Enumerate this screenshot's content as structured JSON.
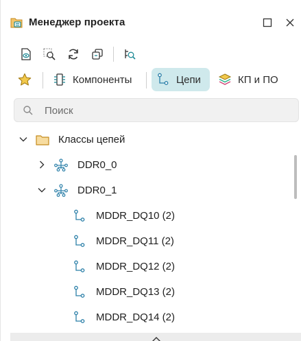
{
  "panel": {
    "title": "Менеджер проекта",
    "title_icon": "project-manager-icon",
    "window_buttons": [
      "maximize-icon",
      "close-icon"
    ]
  },
  "toolbar": {
    "buttons": [
      "document-view-icon",
      "zoom-select-icon",
      "refresh-icon",
      "copy-layers-icon",
      "inspect-net-icon"
    ]
  },
  "tabs": [
    {
      "label": "",
      "icon": "star-icon",
      "active": false
    },
    {
      "label": "Компоненты",
      "icon": "component-icon",
      "active": false
    },
    {
      "label": "Цепи",
      "icon": "net-icon",
      "active": true
    },
    {
      "label": "КП и ПО",
      "icon": "layers-stack-icon",
      "active": false
    }
  ],
  "search": {
    "placeholder": "Поиск",
    "value": ""
  },
  "tree": {
    "root": {
      "label": "Классы цепей",
      "expanded": true,
      "icon": "folder-icon"
    },
    "groups": [
      {
        "label": "DDR0_0",
        "expanded": false,
        "icon": "net-class-icon"
      },
      {
        "label": "DDR0_1",
        "expanded": true,
        "icon": "net-class-icon"
      }
    ],
    "nets": [
      {
        "label": "MDDR_DQ10 (2)",
        "icon": "net-icon"
      },
      {
        "label": "MDDR_DQ11 (2)",
        "icon": "net-icon"
      },
      {
        "label": "MDDR_DQ12 (2)",
        "icon": "net-icon"
      },
      {
        "label": "MDDR_DQ13 (2)",
        "icon": "net-icon"
      },
      {
        "label": "MDDR_DQ14 (2)",
        "icon": "net-icon"
      }
    ]
  },
  "colors": {
    "accent": "#1f8a96",
    "active_tab_bg": "#cfe9ec",
    "folder": "#e0a84a",
    "star": "#e6b434",
    "net_icon": "#2b7fa8"
  }
}
